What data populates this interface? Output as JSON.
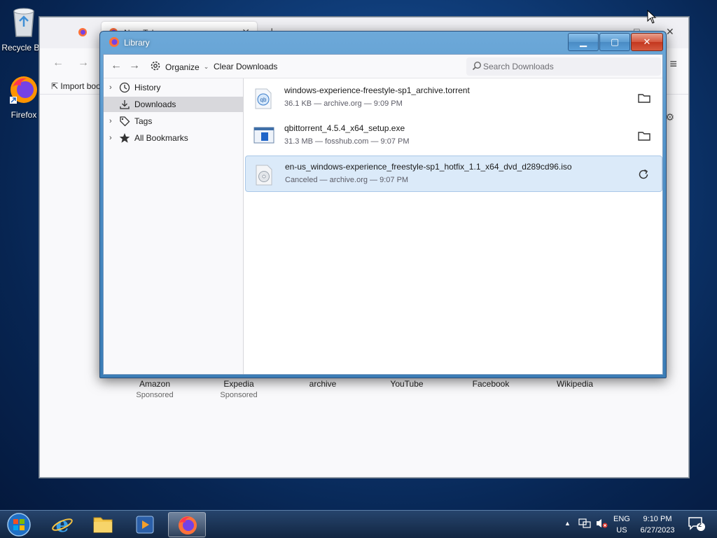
{
  "desktop": {
    "icons": [
      {
        "label": "Recycle Bin",
        "icon": "recycle-bin-icon"
      },
      {
        "label": "Firefox",
        "icon": "firefox-icon"
      }
    ]
  },
  "browser": {
    "tab": {
      "title": "New Tab"
    },
    "bookmarks_bar": {
      "import_label": "Import bookmarks..."
    },
    "shortcuts": [
      {
        "name": "Amazon",
        "sub": "Sponsored"
      },
      {
        "name": "Expedia",
        "sub": "Sponsored"
      },
      {
        "name": "archive",
        "sub": ""
      },
      {
        "name": "YouTube",
        "sub": ""
      },
      {
        "name": "Facebook",
        "sub": ""
      },
      {
        "name": "Wikipedia",
        "sub": ""
      }
    ]
  },
  "library": {
    "title": "Library",
    "toolbar": {
      "organize_label": "Organize",
      "clear_label": "Clear Downloads",
      "search_placeholder": "Search Downloads"
    },
    "sidebar": {
      "items": [
        {
          "label": "History",
          "icon": "clock-icon",
          "expandable": true,
          "selected": false
        },
        {
          "label": "Downloads",
          "icon": "download-icon",
          "expandable": false,
          "selected": true
        },
        {
          "label": "Tags",
          "icon": "tag-icon",
          "expandable": true,
          "selected": false
        },
        {
          "label": "All Bookmarks",
          "icon": "star-icon",
          "expandable": true,
          "selected": false
        }
      ]
    },
    "downloads": [
      {
        "name": "windows-experience-freestyle-sp1_archive.torrent",
        "meta": "36.1 KB — archive.org — 9:09 PM",
        "icon": "torrent-file-icon",
        "action": "folder-icon",
        "selected": false
      },
      {
        "name": "qbittorrent_4.5.4_x64_setup.exe",
        "meta": "31.3 MB — fosshub.com — 9:07 PM",
        "icon": "installer-file-icon",
        "action": "folder-icon",
        "selected": false
      },
      {
        "name": "en-us_windows-experience_freestyle-sp1_hotfix_1.1_x64_dvd_d289cd96.iso",
        "meta": "Canceled — archive.org — 9:07 PM",
        "icon": "disc-image-icon",
        "action": "retry-icon",
        "selected": true
      }
    ]
  },
  "taskbar": {
    "language": {
      "line1": "ENG",
      "line2": "US"
    },
    "clock": {
      "time": "9:10 PM",
      "date": "6/27/2023"
    },
    "notification_count": "2"
  },
  "colors": {
    "selection_bg": "#dbeaf9",
    "sidebar_selected": "#d8d8dc",
    "titlebar": "#4e8fc6",
    "close_button": "#c3371f"
  }
}
